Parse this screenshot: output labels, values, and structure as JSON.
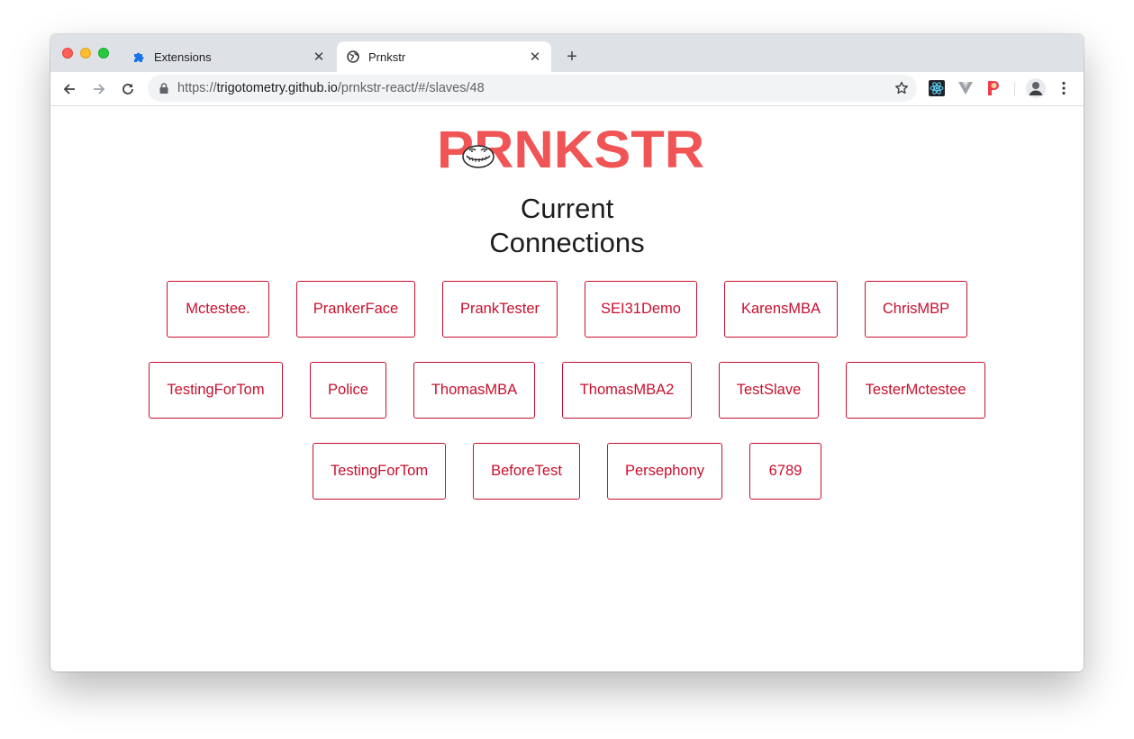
{
  "browser": {
    "tabs": [
      {
        "label": "Extensions",
        "icon": "puzzle-icon",
        "active": false
      },
      {
        "label": "Prnkstr",
        "icon": "globe-icon",
        "active": true
      }
    ],
    "url": {
      "scheme": "https://",
      "host": "trigotometry.github.io",
      "path": "/prnkstr-react/#/slaves/48"
    },
    "extensions": [
      "react-devtools-icon",
      "vue-devtools-icon",
      "prnkstr-extension-icon"
    ],
    "profile_icon": "avatar"
  },
  "page": {
    "logo_text": "PRNKSTR",
    "heading_line1": "Current",
    "heading_line2": "Connections",
    "connections": [
      "Mctestee.",
      "PrankerFace",
      "PrankTester",
      "SEI31Demo",
      "KarensMBA",
      "ChrisMBP",
      "TestingForTom",
      "Police",
      "ThomasMBA",
      "ThomasMBA2",
      "TestSlave",
      "TesterMctestee",
      "TestingForTom",
      "BeforeTest",
      "Persephony",
      "6789"
    ]
  },
  "colors": {
    "accent": "#c8102e",
    "logo": "#f05454",
    "tabbar": "#dee1e6"
  }
}
